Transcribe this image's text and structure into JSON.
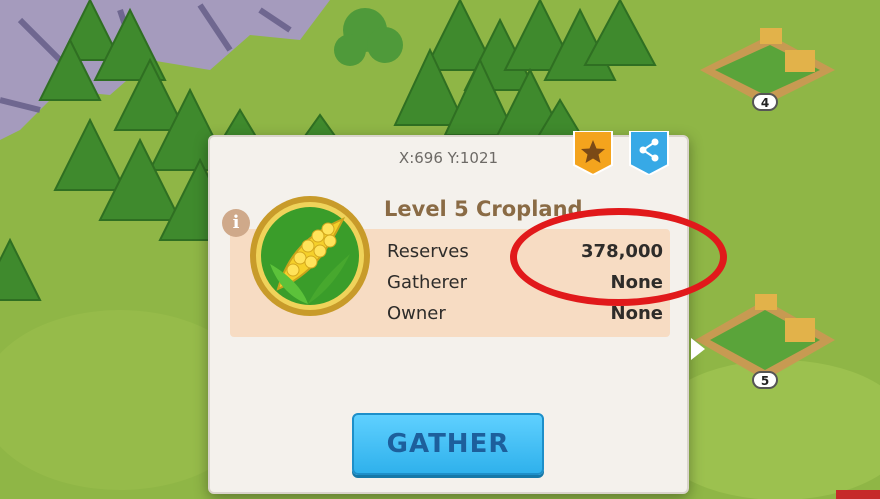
{
  "popup": {
    "coords": "X:696 Y:1021",
    "title": "Level 5 Cropland",
    "rows": [
      {
        "label": "Reserves",
        "value": "378,000"
      },
      {
        "label": "Gatherer",
        "value": "None"
      },
      {
        "label": "Owner",
        "value": "None"
      }
    ],
    "gather_label": "GATHER",
    "icons": {
      "favorite": "star-icon",
      "share": "share-icon",
      "info": "info-icon",
      "resource": "corn-icon"
    }
  },
  "map": {
    "plots": [
      {
        "level": "4"
      },
      {
        "level": "5"
      }
    ]
  },
  "colors": {
    "highlight": "#e1191b",
    "gather_button": "#3bbcf2",
    "title": "#8a6b45",
    "favorite_badge": "#f4a41d",
    "share_badge": "#37a9e6"
  }
}
